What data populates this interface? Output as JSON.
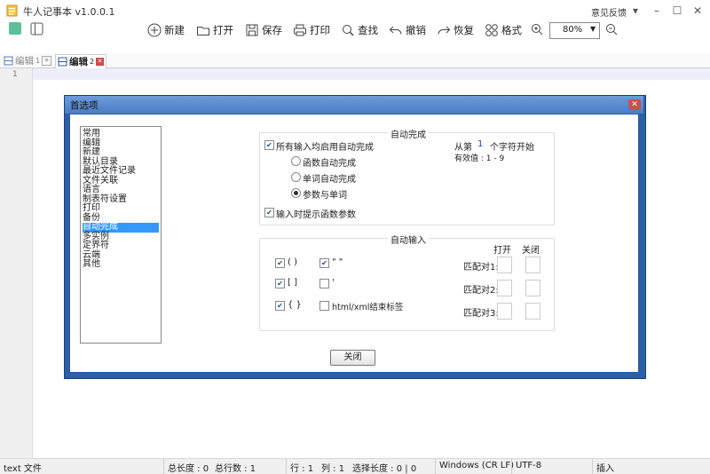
{
  "app": {
    "title": "牛人记事本 v1.0.0.1",
    "feedback": "意见反馈"
  },
  "toolbar": {
    "new": "新建",
    "open": "打开",
    "save": "保存",
    "print": "打印",
    "find": "查找",
    "undo": "撤销",
    "redo": "恢复",
    "format": "格式",
    "zoom": "80%"
  },
  "tabs": [
    {
      "label": "编辑",
      "num": "1",
      "active": false
    },
    {
      "label": "编辑",
      "num": "2",
      "active": true
    }
  ],
  "editor": {
    "line_number": "1"
  },
  "status": {
    "type": "text 文件",
    "total_length": "总长度 : 0",
    "total_lines": "总行数 : 1",
    "row": "行 : 1",
    "col": "列 : 1",
    "selection": "选择长度 : 0 | 0",
    "eol": "Windows (CR LF)",
    "encoding": "UTF-8",
    "mode": "插入"
  },
  "dialog": {
    "title": "首选项",
    "categories": [
      "常用",
      "编辑",
      "新建",
      "默认目录",
      "最近文件记录",
      "文件关联",
      "语言",
      "制表符设置",
      "打印",
      "备份",
      "自动完成",
      "多实例",
      "定界符",
      "云端",
      "其他"
    ],
    "selected_index": 10,
    "autocomplete": {
      "title": "自动完成",
      "enable_all": "所有输入均启用自动完成",
      "func": "函数自动完成",
      "word": "单词自动完成",
      "param_word": "参数与单词",
      "hint_params": "输入时提示函数参数",
      "from_prefix": "从第",
      "from_value": "1",
      "from_suffix": "个字符开始",
      "valid": "有效值 : 1 - 9"
    },
    "autoinput": {
      "title": "自动输入",
      "paren": "( )",
      "bracket": "[ ]",
      "brace": "{ }",
      "dquote": "\" \"",
      "squote": "'",
      "html": "html/xml结束标签",
      "open_header": "打开",
      "close_header": "关闭",
      "match1": "匹配对1:",
      "match2": "匹配对2:",
      "match3": "匹配对3:"
    },
    "close_label": "关闭"
  }
}
